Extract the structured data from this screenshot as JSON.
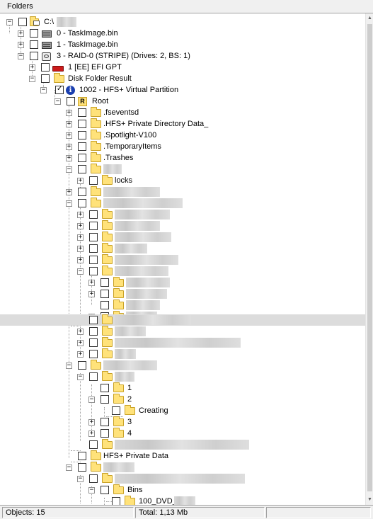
{
  "panel": {
    "title": "Folders"
  },
  "status": {
    "objects": "Objects: 15",
    "total": "Total: 1,13 Mb"
  },
  "tree": {
    "drive_label": "C:\\",
    "task_image_0": "0 - TaskImage.bin",
    "task_image_1": "1 - TaskImage.bin",
    "raid": "3 - RAID-0 (STRIPE) (Drives: 2, BS: 1)",
    "efi": "1 [EE] EFI GPT",
    "disk_folder_result": "Disk Folder Result",
    "partition": "1002 - HFS+ Virtual Partition",
    "root": "Root",
    "fseventsd": ".fseventsd",
    "hfs_private_dir": ".HFS+ Private Directory Data_",
    "spotlight": ".Spotlight-V100",
    "temporary_items": ".TemporaryItems",
    "trashes": ".Trashes",
    "locks": "locks",
    "folder_1": "1",
    "folder_2": "2",
    "creating": "Creating",
    "folder_3": "3",
    "folder_4": "4",
    "hfs_private_data": "HFS+ Private Data",
    "bins": "Bins",
    "dvd": "100_DVD_"
  },
  "icons": {
    "expanded": "minus-box",
    "collapsed": "plus-box",
    "folder": "folder-icon",
    "disk_image": "disk-image-icon",
    "raid": "raid-icon",
    "partition_efi": "efi-partition-icon",
    "info": "info-icon",
    "root": "root-folder-icon",
    "computer": "computer-folder-icon"
  },
  "colors": {
    "folder": "#ffe27a",
    "highlight_row": "#dcdcdc",
    "info_blue": "#1a3fb0",
    "efi_red": "#cc1b1b"
  }
}
